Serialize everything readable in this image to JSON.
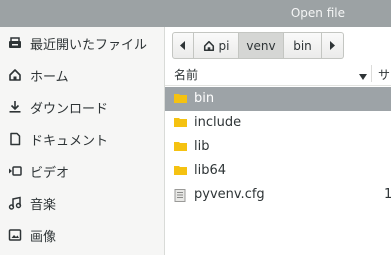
{
  "window": {
    "title": "Open file"
  },
  "sidebar": {
    "items": [
      {
        "label": "最近開いたファイル",
        "icon": "recent-icon"
      },
      {
        "label": "ホーム",
        "icon": "home-icon"
      },
      {
        "label": "ダウンロード",
        "icon": "download-icon"
      },
      {
        "label": "ドキュメント",
        "icon": "document-icon"
      },
      {
        "label": "ビデオ",
        "icon": "video-icon"
      },
      {
        "label": "音楽",
        "icon": "music-icon"
      },
      {
        "label": "画像",
        "icon": "image-icon"
      }
    ]
  },
  "pathbar": {
    "back_icon": "chevron-left-icon",
    "forward_icon": "chevron-right-icon",
    "crumbs": [
      {
        "label": "pi",
        "icon": "home-icon"
      },
      {
        "label": "venv"
      },
      {
        "label": "bin"
      }
    ]
  },
  "columns": {
    "name": "名前",
    "size": "サ"
  },
  "files": [
    {
      "name": "bin",
      "type": "folder",
      "selected": true
    },
    {
      "name": "include",
      "type": "folder"
    },
    {
      "name": "lib",
      "type": "folder"
    },
    {
      "name": "lib64",
      "type": "folder"
    },
    {
      "name": "pyvenv.cfg",
      "type": "file",
      "size": "1"
    }
  ],
  "colors": {
    "folder": "#f5c211",
    "selection": "#9da3a7",
    "titlebar": "#9ca2a4"
  }
}
